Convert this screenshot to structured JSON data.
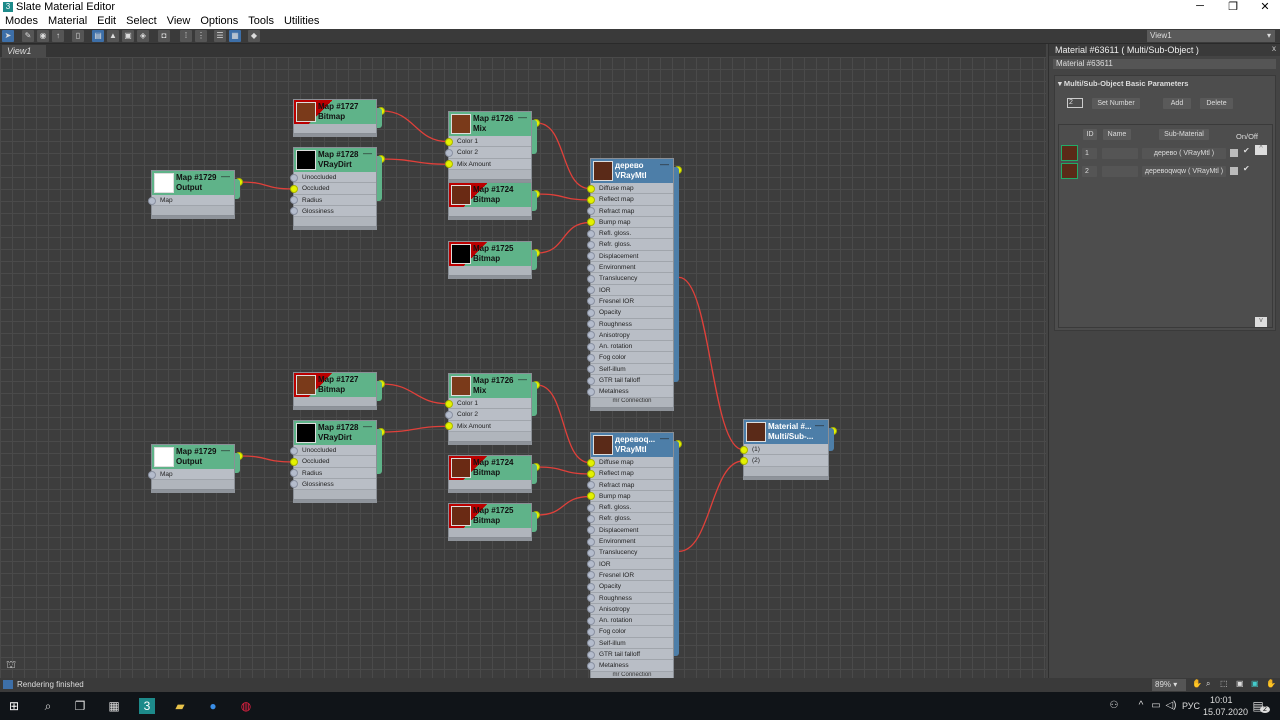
{
  "window": {
    "title": "Slate Material Editor",
    "app_icon": "3"
  },
  "menu": [
    "Modes",
    "Material",
    "Edit",
    "Select",
    "View",
    "Options",
    "Tools",
    "Utilities"
  ],
  "view_selector": "View1",
  "tab": "View1",
  "nodes": [
    {
      "title": "Map #1727",
      "type": "Bitmap",
      "kind": "bitmap",
      "thumb": "#7a3a1a",
      "ports": []
    },
    {
      "title": "Map #1728",
      "type": "VRayDirt",
      "kind": "map",
      "thumb": "#000000",
      "ports": [
        {
          "label": "Unoccluded",
          "on": false
        },
        {
          "label": "Occluded",
          "on": true
        },
        {
          "label": "Radius",
          "on": false
        },
        {
          "label": "Glossiness",
          "on": false
        }
      ]
    },
    {
      "title": "Map #1729",
      "type": "Output",
      "kind": "map",
      "thumb": "#ffffff",
      "ports": [
        {
          "label": "Map",
          "on": false
        }
      ]
    },
    {
      "title": "Map #1726",
      "type": "Mix",
      "kind": "map",
      "thumb": "#7a3a1a",
      "ports": [
        {
          "label": "Color 1",
          "on": true
        },
        {
          "label": "Color 2",
          "on": false
        },
        {
          "label": "Mix Amount",
          "on": true
        }
      ]
    },
    {
      "title": "Map #1724",
      "type": "Bitmap",
      "kind": "bitmap",
      "thumb": "#6a2a14",
      "ports": []
    },
    {
      "title": "Map #1725",
      "type": "Bitmap",
      "kind": "bitmap",
      "thumb": "#000000",
      "ports": []
    },
    {
      "title": "дерево",
      "type": "VRayMtl",
      "kind": "mat",
      "thumb": "#5a2a18",
      "footer": "mr Connection",
      "ports": [
        {
          "label": "Diffuse map",
          "on": true
        },
        {
          "label": "Reflect map",
          "on": true
        },
        {
          "label": "Refract map",
          "on": false
        },
        {
          "label": "Bump map",
          "on": true
        },
        {
          "label": "Refl. gloss.",
          "on": false
        },
        {
          "label": "Refr. gloss.",
          "on": false
        },
        {
          "label": "Displacement",
          "on": false
        },
        {
          "label": "Environment",
          "on": false
        },
        {
          "label": "Translucency",
          "on": false
        },
        {
          "label": "IOR",
          "on": false
        },
        {
          "label": "Fresnel IOR",
          "on": false
        },
        {
          "label": "Opacity",
          "on": false
        },
        {
          "label": "Roughness",
          "on": false
        },
        {
          "label": "Anisotropy",
          "on": false
        },
        {
          "label": "An. rotation",
          "on": false
        },
        {
          "label": "Fog color",
          "on": false
        },
        {
          "label": "Self-illum",
          "on": false
        },
        {
          "label": "GTR tail falloff",
          "on": false
        },
        {
          "label": "Metalness",
          "on": false
        }
      ]
    },
    {
      "title": "Map #1727",
      "type": "Bitmap",
      "kind": "bitmap",
      "thumb": "#7a3a1a",
      "ports": []
    },
    {
      "title": "Map #1728",
      "type": "VRayDirt",
      "kind": "map",
      "thumb": "#000000",
      "ports": [
        {
          "label": "Unoccluded",
          "on": false
        },
        {
          "label": "Occluded",
          "on": true
        },
        {
          "label": "Radius",
          "on": false
        },
        {
          "label": "Glossiness",
          "on": false
        }
      ]
    },
    {
      "title": "Map #1729",
      "type": "Output",
      "kind": "map",
      "thumb": "#ffffff",
      "ports": [
        {
          "label": "Map",
          "on": false
        }
      ]
    },
    {
      "title": "Map #1726",
      "type": "Mix",
      "kind": "map",
      "thumb": "#7a3a1a",
      "ports": [
        {
          "label": "Color 1",
          "on": true
        },
        {
          "label": "Color 2",
          "on": false
        },
        {
          "label": "Mix Amount",
          "on": true
        }
      ]
    },
    {
      "title": "Map #1724",
      "type": "Bitmap",
      "kind": "bitmap",
      "thumb": "#6a2a14",
      "ports": []
    },
    {
      "title": "Map #1725",
      "type": "Bitmap",
      "kind": "bitmap",
      "thumb": "#6a2a14",
      "ports": []
    },
    {
      "title": "деревоq...",
      "type": "VRayMtl",
      "kind": "mat",
      "thumb": "#5a2a18",
      "footer": "mr Connection",
      "ports": [
        {
          "label": "Diffuse map",
          "on": true
        },
        {
          "label": "Reflect map",
          "on": true
        },
        {
          "label": "Refract map",
          "on": false
        },
        {
          "label": "Bump map",
          "on": true
        },
        {
          "label": "Refl. gloss.",
          "on": false
        },
        {
          "label": "Refr. gloss.",
          "on": false
        },
        {
          "label": "Displacement",
          "on": false
        },
        {
          "label": "Environment",
          "on": false
        },
        {
          "label": "Translucency",
          "on": false
        },
        {
          "label": "IOR",
          "on": false
        },
        {
          "label": "Fresnel IOR",
          "on": false
        },
        {
          "label": "Opacity",
          "on": false
        },
        {
          "label": "Roughness",
          "on": false
        },
        {
          "label": "Anisotropy",
          "on": false
        },
        {
          "label": "An. rotation",
          "on": false
        },
        {
          "label": "Fog color",
          "on": false
        },
        {
          "label": "Self-illum",
          "on": false
        },
        {
          "label": "GTR tail falloff",
          "on": false
        },
        {
          "label": "Metalness",
          "on": false
        }
      ]
    },
    {
      "title": "Material #...",
      "type": "Multi/Sub-...",
      "kind": "mat",
      "thumb": "#5a2a18",
      "ports": [
        {
          "label": "(1)",
          "on": true
        },
        {
          "label": "(2)",
          "on": true
        }
      ]
    }
  ],
  "panel": {
    "title": "Material #63611  ( Multi/Sub-Object )",
    "name": "Material #63611",
    "rollout": "Multi/Sub-Object Basic Parameters",
    "count": "2",
    "set_number": "Set Number",
    "add": "Add",
    "delete": "Delete",
    "headers": {
      "id": "ID",
      "name": "Name",
      "sub": "Sub-Material",
      "onoff": "On/Off"
    },
    "rows": [
      {
        "id": "1",
        "name": "",
        "sub": "дерево  ( VRayMtl )",
        "on": true
      },
      {
        "id": "2",
        "name": "",
        "sub": "деревоqwqw  ( VRayMtl )",
        "on": true
      }
    ]
  },
  "status": {
    "text": "Rendering finished",
    "zoom": "89%"
  },
  "taskbar": {
    "lang": "РУС",
    "time": "10:01",
    "date": "15.07.2020",
    "notifications": "2"
  }
}
